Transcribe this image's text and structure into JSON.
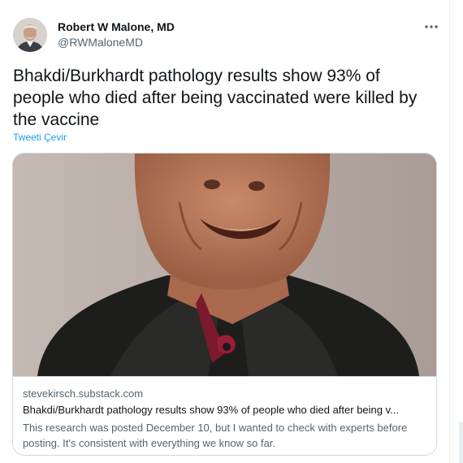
{
  "tweet": {
    "author": {
      "name": "Robert W Malone, MD",
      "handle": "@RWMaloneMD",
      "avatar_icon": "user-avatar-photo"
    },
    "more_icon": "more-horizontal-icon",
    "text": "Bhakdi/Burkhardt pathology results show 93% of people who died after being vaccinated were killed by the vaccine",
    "translate_label": "Tweeti Çevir",
    "card": {
      "image_icon": "article-preview-photo",
      "domain": "stevekirsch.substack.com",
      "title": "Bhakdi/Burkhardt pathology results show 93% of people who died after being v...",
      "description": "This research was posted December 10, but I wanted to check with experts before posting. It's consistent with everything we know so far."
    }
  },
  "colors": {
    "text_primary": "#0f1419",
    "text_secondary": "#536471",
    "accent": "#1d9bf0",
    "border": "#cfd9de"
  }
}
